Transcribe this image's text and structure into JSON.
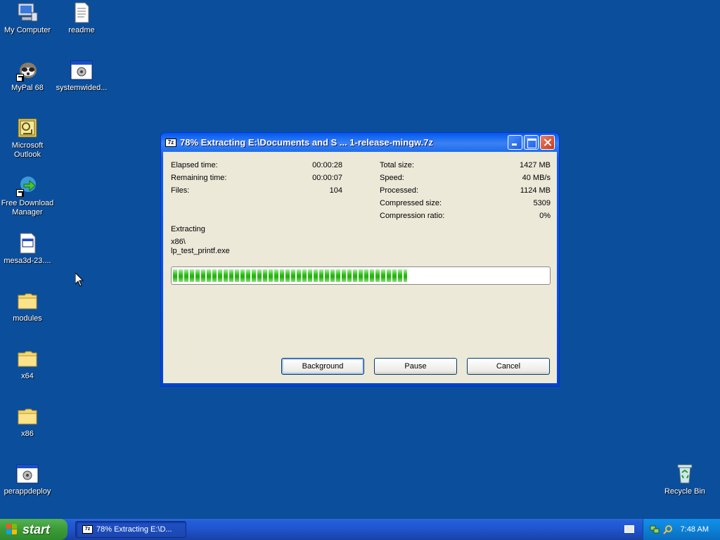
{
  "desktop": {
    "icons": [
      {
        "label": "My Computer",
        "icon": "my-computer-icon"
      },
      {
        "label": "readme",
        "icon": "text-document-icon"
      },
      {
        "label": "MyPal 68",
        "icon": "mypal-browser-icon"
      },
      {
        "label": "systemwided...",
        "icon": "application-window-icon"
      },
      {
        "label": "Microsoft\nOutlook",
        "icon": "outlook-icon"
      },
      {
        "label": "Free Download\nManager",
        "icon": "download-manager-icon"
      },
      {
        "label": "mesa3d-23....",
        "icon": "application-window-icon"
      },
      {
        "label": "modules",
        "icon": "folder-icon"
      },
      {
        "label": "x64",
        "icon": "folder-icon"
      },
      {
        "label": "x86",
        "icon": "folder-icon"
      },
      {
        "label": "perappdeploy",
        "icon": "application-window-icon"
      },
      {
        "label": "Recycle Bin",
        "icon": "recycle-bin-icon"
      }
    ]
  },
  "dialog": {
    "title": "78% Extracting E:\\Documents and S ... 1-release-mingw.7z",
    "app_icon_text": "7z",
    "left_stats": [
      {
        "label": "Elapsed time:",
        "value": "00:00:28"
      },
      {
        "label": "Remaining time:",
        "value": "00:00:07"
      },
      {
        "label": "Files:",
        "value": "104"
      }
    ],
    "right_stats": [
      {
        "label": "Total size:",
        "value": "1427 MB"
      },
      {
        "label": "Speed:",
        "value": "40 MB/s"
      },
      {
        "label": "Processed:",
        "value": "1124 MB"
      },
      {
        "label": "Compressed size:",
        "value": "5309"
      },
      {
        "label": "Compression ratio:",
        "value": "0%"
      }
    ],
    "status_label": "Extracting",
    "current_path": "x86\\",
    "current_file": "lp_test_printf.exe",
    "progress_percent": 78,
    "buttons": {
      "background": "Background",
      "pause": "Pause",
      "cancel": "Cancel"
    }
  },
  "taskbar": {
    "start_label": "start",
    "task_label": "78% Extracting E:\\D...",
    "task_icon_text": "7z",
    "clock": "7:48 AM"
  },
  "colors": {
    "desktop": "#0b4e9c",
    "progress_green": "#2ec31a",
    "titlebar_blue": "#0256e0"
  }
}
